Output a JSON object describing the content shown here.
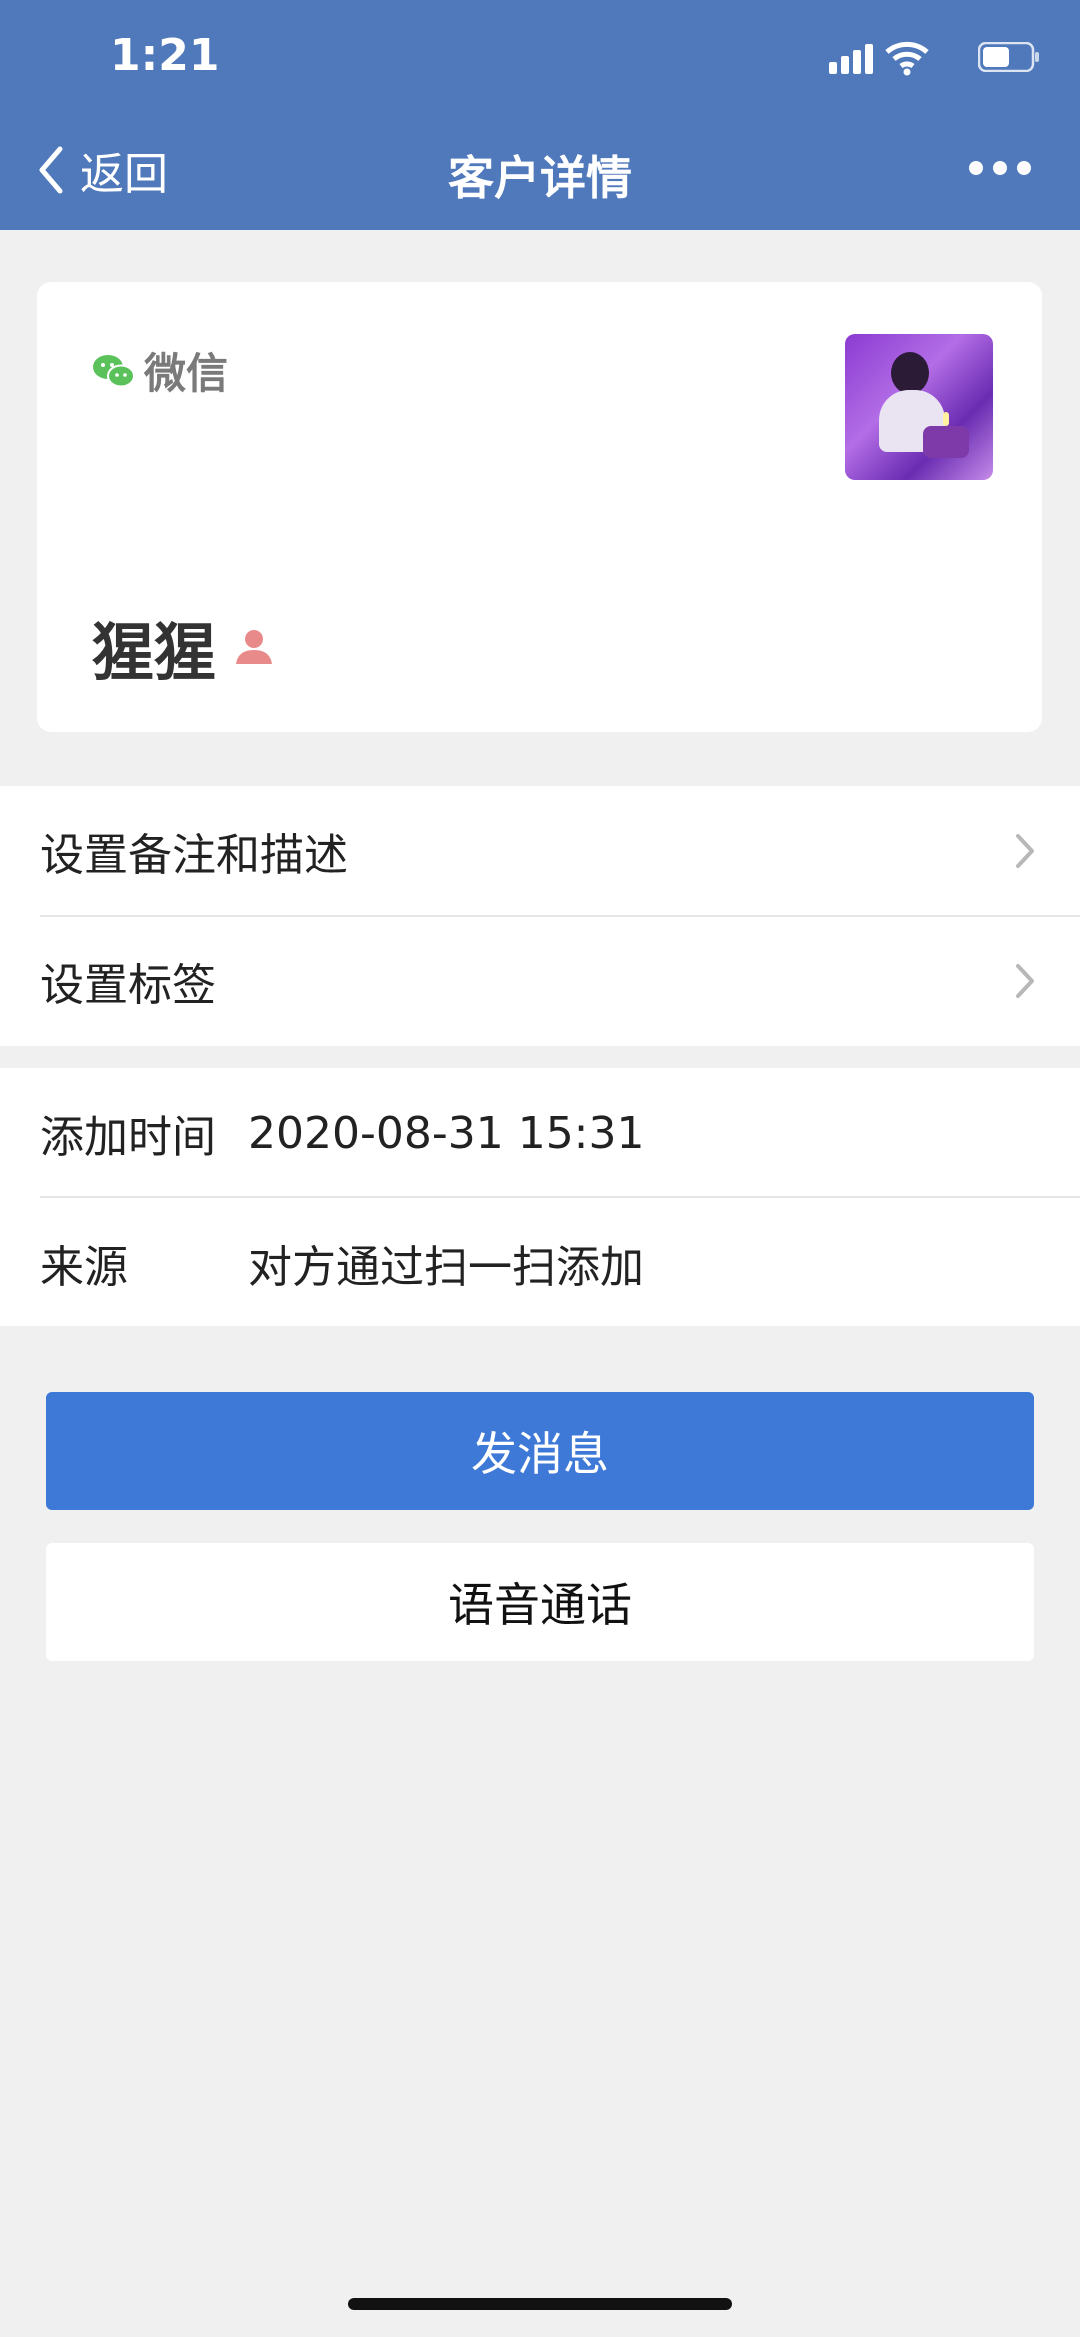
{
  "status_bar": {
    "time": "1:21"
  },
  "nav": {
    "back_label": "返回",
    "title": "客户详情"
  },
  "card": {
    "platform_label": "微信",
    "customer_name": "猩猩"
  },
  "settings": [
    {
      "label": "设置备注和描述"
    },
    {
      "label": "设置标签"
    }
  ],
  "info": [
    {
      "label": "添加时间",
      "value": "2020-08-31 15:31"
    },
    {
      "label": "来源",
      "value": "对方通过扫一扫添加"
    }
  ],
  "actions": {
    "primary_label": "发消息",
    "secondary_label": "语音通话"
  },
  "colors": {
    "header": "#5079bb",
    "primary_button": "#3f79d8",
    "wechat_green": "#5bc25b",
    "person_icon": "#e98a8a"
  }
}
